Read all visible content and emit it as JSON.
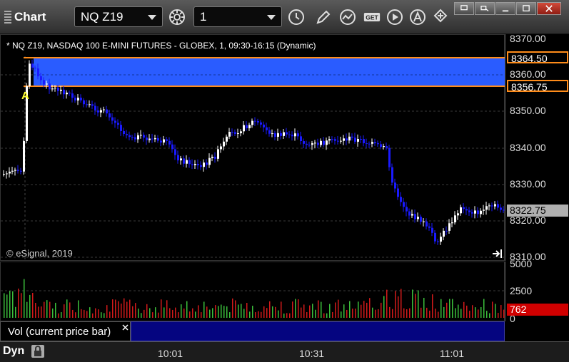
{
  "window": {
    "title": "Chart"
  },
  "toolbar": {
    "symbol": "NQ Z19",
    "interval": "1",
    "get_label": "GET"
  },
  "chart": {
    "info": "* NQ Z19, NASDAQ 100 E-MINI FUTURES - GLOBEX, 1, 09:30-16:15 (Dynamic)",
    "marker": "A",
    "copyright": "© eSignal, 2019",
    "price_ticks": [
      "8370.00",
      "8360.00",
      "8350.00",
      "8340.00",
      "8330.00",
      "8320.00",
      "8310.00"
    ],
    "price_labels": {
      "upper": "8364.50",
      "lower": "8356.75",
      "last": "8322.75"
    },
    "colors": {
      "zone": "#2a5cff",
      "zone_border": "#ff8c1a",
      "down": "#1a1aff",
      "up": "#ffffff",
      "last_bg": "#b0b0b0"
    }
  },
  "volume": {
    "ticks": [
      "5000",
      "2500",
      "0"
    ],
    "last": "762",
    "legend": "Vol (current price bar)",
    "colors": {
      "up": "#3bbf3b",
      "down": "#d11a1a",
      "last_bg": "#d00000"
    }
  },
  "time_axis": {
    "ticks": [
      "10:01",
      "10:31",
      "11:01"
    ],
    "mode": "Dyn"
  }
}
